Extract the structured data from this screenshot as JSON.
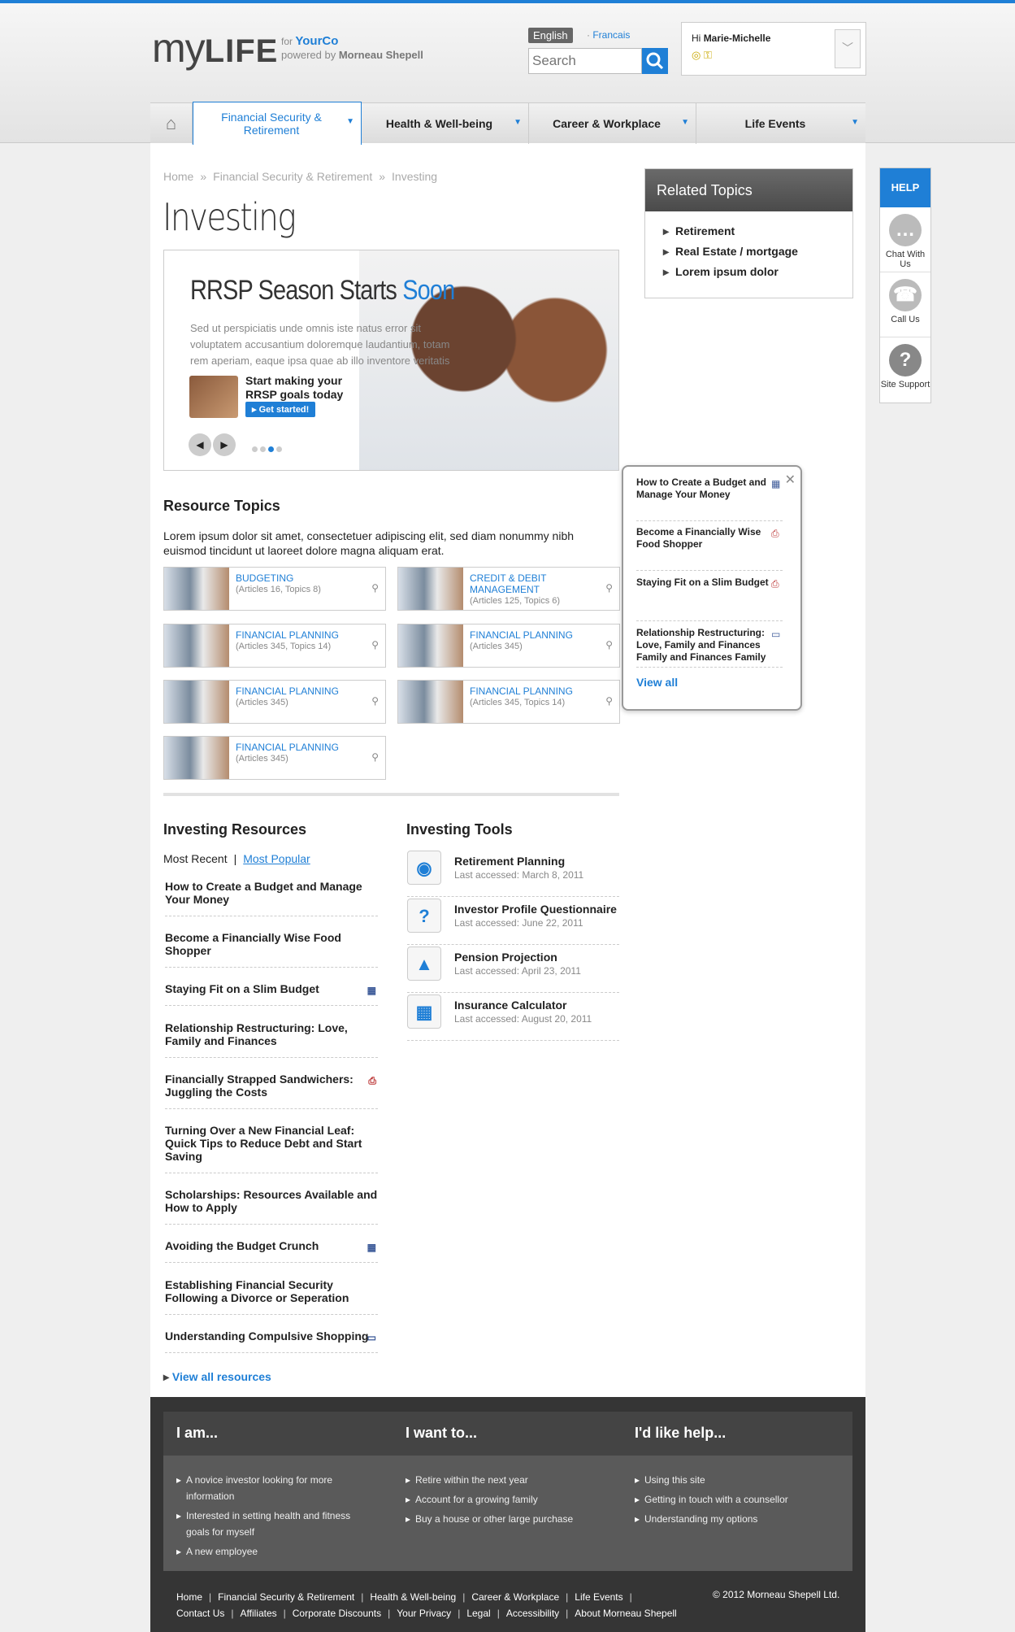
{
  "header": {
    "logo_my": "my",
    "logo_life": "LIFE",
    "for_label": "for",
    "company": "YourCo",
    "powered_label": "powered by",
    "powered_by": "Morneau Shepell",
    "lang_english": "English",
    "lang_french": "Francais",
    "search_placeholder": "Search",
    "user_greeting": "Hi",
    "user_name": "Marie-Michelle",
    "user_icons": "◎ ⚿"
  },
  "nav": {
    "home_icon": "⌂",
    "items": [
      {
        "label": "Financial Security & Retirement",
        "active": true
      },
      {
        "label": "Health & Well-being"
      },
      {
        "label": "Career & Workplace"
      },
      {
        "label": "Life Events"
      }
    ]
  },
  "breadcrumb": [
    "Home",
    "Financial Security & Retirement",
    "Investing"
  ],
  "page_title": "Investing",
  "hero": {
    "title_a": "RRSP Season Starts",
    "title_b": "Soon",
    "text": "Sed ut perspiciatis unde omnis iste natus error sit voluptatem accusantium doloremque laudantium, totam rem aperiam, eaque ipsa quae ab illo inventore veritatis et",
    "cta": "Start making your RRSP goals today",
    "button": "Get started!",
    "prev": "◀",
    "next": "▶"
  },
  "related": {
    "title": "Related Topics",
    "items": [
      "Retirement",
      "Real Estate / mortgage",
      "Lorem ipsum dolor"
    ]
  },
  "help": {
    "title": "HELP",
    "items": [
      {
        "label": "Chat With Us",
        "icon": "chat-icon",
        "glyph": "…"
      },
      {
        "label": "Call Us",
        "icon": "phone-icon",
        "glyph": "☎"
      },
      {
        "label": "Site Support",
        "icon": "question-icon",
        "glyph": "?"
      }
    ]
  },
  "resource_topics": {
    "title": "Resource Topics",
    "description": "Lorem ipsum dolor sit amet, consectetuer adipiscing elit, sed diam nonummy nibh euismod tincidunt ut laoreet dolore magna aliquam erat.",
    "tiles": [
      {
        "name": "BUDGETING",
        "meta": "(Articles 16, Topics 8)"
      },
      {
        "name": "CREDIT & DEBIT MANAGEMENT",
        "meta": "(Articles 125, Topics 6)"
      },
      {
        "name": "FINANCIAL PLANNING",
        "meta": "(Articles 345, Topics 14)"
      },
      {
        "name": "FINANCIAL PLANNING",
        "meta": "(Articles 345)"
      },
      {
        "name": "FINANCIAL PLANNING",
        "meta": "(Articles 345)"
      },
      {
        "name": "FINANCIAL PLANNING",
        "meta": "(Articles 345, Topics 14)"
      },
      {
        "name": "FINANCIAL PLANNING",
        "meta": "(Articles 345)"
      }
    ]
  },
  "popup": {
    "items": [
      {
        "title": "How to Create a Budget and Manage Your Money",
        "icon": "video-icon"
      },
      {
        "title": "Become a Financially Wise Food Shopper",
        "icon": "pdf-icon"
      },
      {
        "title": "Staying Fit on a Slim Budget",
        "icon": "pdf-icon"
      },
      {
        "title": "Relationship Restructuring: Love, Family and Finances Family and Finances Family",
        "icon": "monitor-icon"
      }
    ],
    "view_all": "View all"
  },
  "investing_resources": {
    "title": "Investing Resources",
    "tab_recent": "Most Recent",
    "tab_popular": "Most Popular",
    "items": [
      {
        "title": "How to Create a Budget and Manage Your Money",
        "icon": ""
      },
      {
        "title": "Become a Financially Wise Food Shopper",
        "icon": ""
      },
      {
        "title": "Staying Fit on a Slim Budget",
        "icon": "video-icon"
      },
      {
        "title": "Relationship Restructuring: Love, Family and Finances",
        "icon": ""
      },
      {
        "title": "Financially Strapped Sandwichers: Juggling the Costs",
        "icon": "pdf-icon"
      },
      {
        "title": "Turning Over a New Financial Leaf: Quick Tips to Reduce Debt and Start Saving",
        "icon": ""
      },
      {
        "title": "Scholarships: Resources Available and How to Apply",
        "icon": ""
      },
      {
        "title": "Avoiding the Budget Crunch",
        "icon": "video-icon"
      },
      {
        "title": "Establishing Financial Security Following a Divorce or Seperation",
        "icon": ""
      },
      {
        "title": "Understanding Compulsive Shopping",
        "icon": "monitor-icon"
      }
    ],
    "view_all": "View all resources"
  },
  "investing_tools": {
    "title": "Investing Tools",
    "items": [
      {
        "name": "Retirement Planning",
        "date": "Last accessed: March 8, 2011",
        "icon": "piggy-bank-icon",
        "glyph": "◉"
      },
      {
        "name": "Investor Profile Questionnaire",
        "date": "Last accessed: June 22, 2011",
        "icon": "question-icon",
        "glyph": "?"
      },
      {
        "name": "Pension Projection",
        "date": "Last accessed: April 23, 2011",
        "icon": "chart-icon",
        "glyph": "▲"
      },
      {
        "name": "Insurance Calculator",
        "date": "Last accessed: August 20, 2011",
        "icon": "calculator-icon",
        "glyph": "▦"
      }
    ]
  },
  "footer": {
    "cols": [
      {
        "title": "I am...",
        "items": [
          "A novice investor looking for more information",
          "Interested in setting health and fitness goals for myself",
          "A new employee"
        ]
      },
      {
        "title": "I want to...",
        "items": [
          "Retire within the next year",
          "Account for a growing family",
          "Buy a house or other large purchase"
        ]
      },
      {
        "title": "I'd like help...",
        "items": [
          "Using this site",
          "Getting in touch with a counsellor",
          "Understanding my options"
        ]
      }
    ],
    "links_row1": [
      "Home",
      "Financial Security & Retirement",
      "Health & Well-being",
      "Career & Workplace",
      "Life Events"
    ],
    "links_row2": [
      "Contact Us",
      "Affiliates",
      "Corporate Discounts",
      "Your Privacy",
      "Legal",
      "Accessibility",
      "About Morneau Shepell"
    ],
    "copyright": "© 2012 Morneau Shepell Ltd."
  },
  "colors": {
    "accent": "#1f7fd6",
    "footer_bg": "#353535"
  }
}
